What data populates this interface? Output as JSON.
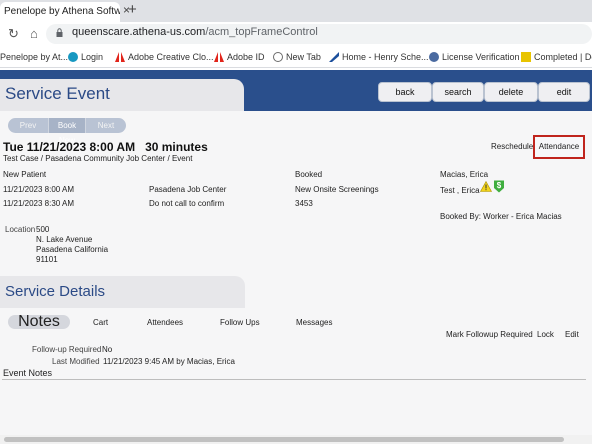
{
  "browser": {
    "tab_title": "Penelope by Athena Softwa",
    "close_symbol": "×",
    "new_tab_symbol": "+",
    "url_host": "queenscare.athena-us.com",
    "url_path": "/acm_topFrameControl",
    "bookmarks": [
      {
        "label": "Penelope by At...",
        "icon": "penelope-icon",
        "color": "#6a8fc9"
      },
      {
        "label": "Login",
        "icon": "salesforce-icon",
        "color": "#1798c1"
      },
      {
        "label": "Adobe Creative Clo...",
        "icon": "adobe-icon",
        "color": "#e1251b"
      },
      {
        "label": "Adobe ID",
        "icon": "adobe-icon",
        "color": "#e1251b"
      },
      {
        "label": "New Tab",
        "icon": "globe-icon",
        "color": "#6b6b6b"
      },
      {
        "label": "Home - Henry Sche...",
        "icon": "henry-schein-icon",
        "color": "#1c4f9c"
      },
      {
        "label": "License Verification",
        "icon": "verification-icon",
        "color": "#4a6aa0"
      },
      {
        "label": "Completed | Do",
        "icon": "download-icon",
        "color": "#e8c400"
      }
    ]
  },
  "app": {
    "page_title": "Service Event",
    "toolbar": {
      "back": "back",
      "search": "search",
      "delete": "delete",
      "edit": "edit"
    },
    "pager": {
      "prev": "Prev",
      "book_new": "Book New",
      "next": "Next"
    },
    "event": {
      "datetime": "Tue 11/21/2023 8:00 AM   30 minutes",
      "subtitle": "Test Case / Pasadena Community Job Center / Event",
      "reschedule": "Reschedule",
      "attendance": "Attendance"
    },
    "details": {
      "status": "New Patient",
      "booked": "Booked",
      "owner": "Macias, Erica",
      "start": "11/21/2023 8:00 AM",
      "site": "Pasadena Job Center",
      "service": "New Onsite Screenings",
      "attendee": "Test , Erica",
      "end": "11/21/2023 8:30 AM",
      "contact_note": "Do not call to confirm",
      "code": "3453",
      "booked_by": "Booked By: Worker - Erica  Macias",
      "location_label": "Location",
      "address": [
        "500",
        "N. Lake Avenue",
        "Pasadena California",
        "91101"
      ]
    },
    "service_details": {
      "title": "Service Details",
      "tabs": [
        "Notes",
        "Cart",
        "Attendees",
        "Follow Ups",
        "Messages"
      ],
      "mark_followup": "Mark Followup Required",
      "lock": "Lock",
      "edit": "Edit",
      "followup_label": "Follow-up Required",
      "followup_value": "No",
      "modified_label": "Last Modified",
      "modified_value": "11/21/2023 9:45 AM by Macias, Erica",
      "event_notes": "Event Notes"
    }
  },
  "colors": {
    "header_blue": "#2a4f8c",
    "title_blue": "#2b4a86",
    "highlight_red": "#c0241d"
  }
}
